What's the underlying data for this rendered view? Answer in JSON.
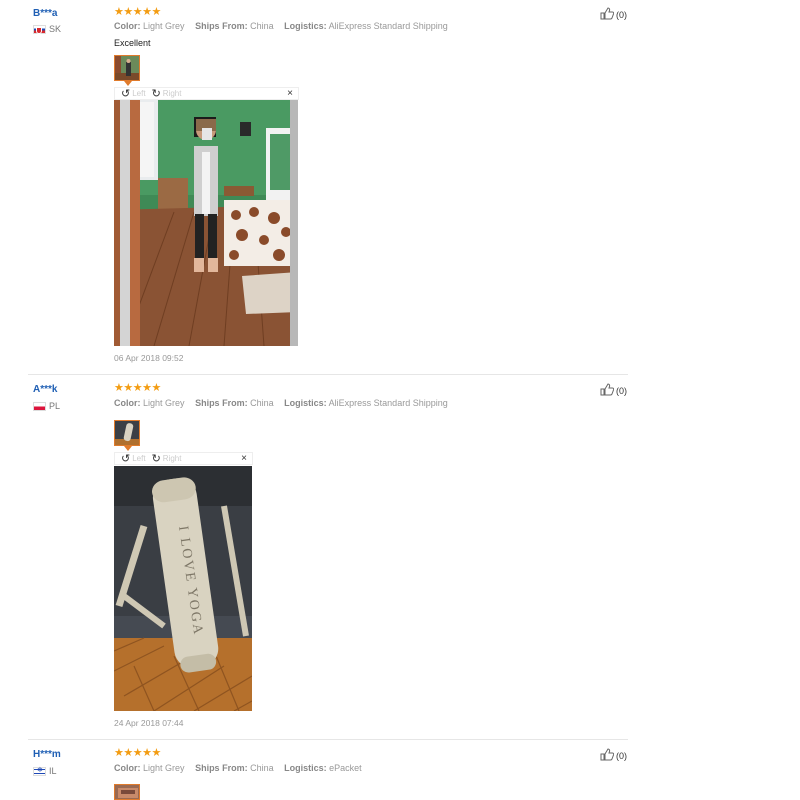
{
  "reviews": [
    {
      "user": "B***a",
      "country": "SK",
      "stars": "★★★★★",
      "color_label": "Color:",
      "color_value": "Light Grey",
      "ships_label": "Ships From:",
      "ships_value": "China",
      "logistics_label": "Logistics:",
      "logistics_value": "AliExpress Standard Shipping",
      "comment": "Excellent",
      "rotate_left": "Left",
      "rotate_right": "Right",
      "close": "×",
      "date": "06 Apr 2018 09:52",
      "likes": "(0)"
    },
    {
      "user": "A***k",
      "country": "PL",
      "stars": "★★★★★",
      "color_label": "Color:",
      "color_value": "Light Grey",
      "ships_label": "Ships From:",
      "ships_value": "China",
      "logistics_label": "Logistics:",
      "logistics_value": "AliExpress Standard Shipping",
      "rotate_left": "Left",
      "rotate_right": "Right",
      "close": "×",
      "photo_text": "I LOVE YOGA",
      "date": "24 Apr 2018 07:44",
      "likes": "(0)"
    },
    {
      "user": "H***m",
      "country": "IL",
      "stars": "★★★★★",
      "color_label": "Color:",
      "color_value": "Light Grey",
      "ships_label": "Ships From:",
      "ships_value": "China",
      "logistics_label": "Logistics:",
      "logistics_value": "ePacket",
      "likes": "(0)"
    }
  ],
  "icons": {
    "like": "thumbs-up-icon",
    "rotate_left": "rotate-left-icon",
    "rotate_right": "rotate-right-icon",
    "close": "close-icon"
  },
  "colors": {
    "username": "#1f5fb4",
    "stars": "#f39c12",
    "thumb_border": "#e07b2c"
  }
}
